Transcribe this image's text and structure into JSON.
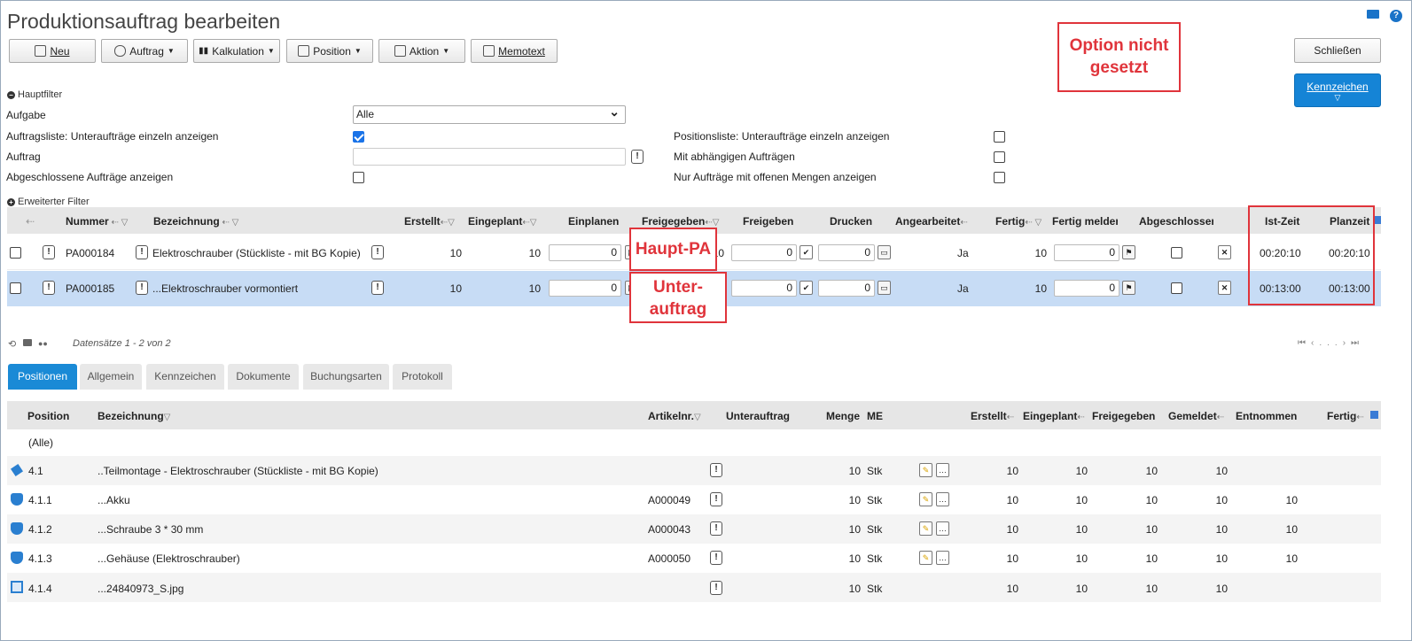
{
  "title": "Produktionsauftrag bearbeiten",
  "toolbar": {
    "neu": "Neu",
    "auftrag": "Auftrag",
    "kalkulation": "Kalkulation",
    "position": "Position",
    "aktion": "Aktion",
    "memotext": "Memotext",
    "schliessen": "Schließen",
    "kennzeichen": "Kennzeichen"
  },
  "annotations": {
    "option_line1": "Option nicht",
    "option_line2": "gesetzt",
    "haupt": "Haupt-PA",
    "unter_line1": "Unter-",
    "unter_line2": "auftrag"
  },
  "filter": {
    "hauptfilter": "Hauptfilter",
    "aufgabe_label": "Aufgabe",
    "aufgabe_value": "Alle",
    "auftragsliste_label": "Auftragsliste: Unteraufträge einzeln anzeigen",
    "auftragsliste_checked": true,
    "positionsliste_label": "Positionsliste: Unteraufträge einzeln anzeigen",
    "auftrag_label": "Auftrag",
    "auftrag_value": "",
    "abhaengig_label": "Mit abhängigen Aufträgen",
    "abgeschlossen_label": "Abgeschlossene Aufträge anzeigen",
    "offene_label": "Nur Aufträge mit offenen Mengen anzeigen",
    "erweitert": "Erweiterter Filter"
  },
  "orders": {
    "headers": {
      "nummer": "Nummer",
      "bezeichnung": "Bezeichnung",
      "erstellt": "Erstellt",
      "eingeplant": "Eingeplant",
      "einplanen": "Einplanen",
      "freigegeben": "Freigegeben",
      "freigeben": "Freigeben",
      "drucken": "Drucken",
      "angearbeitet": "Angearbeitet",
      "fertig": "Fertig",
      "fertig_melden": "Fertig melden",
      "abgeschlossen": "Abgeschlossen",
      "ist_zeit": "Ist-Zeit",
      "planzeit": "Planzeit"
    },
    "rows": [
      {
        "nummer": "PA000184",
        "bezeichnung": "Elektroschrauber (Stückliste - mit BG Kopie)",
        "erstellt": "10",
        "eingeplant": "10",
        "einplanen": "0",
        "freigegeben": "10",
        "freigeben": "0",
        "drucken": "0",
        "angearbeitet": "Ja",
        "fertig": "10",
        "fertig_melden": "0",
        "ist_zeit": "00:20:10",
        "planzeit": "00:20:10"
      },
      {
        "nummer": "PA000185",
        "bezeichnung": "...Elektroschrauber vormontiert",
        "erstellt": "10",
        "eingeplant": "10",
        "einplanen": "0",
        "freigegeben": "10",
        "freigeben": "0",
        "drucken": "0",
        "angearbeitet": "Ja",
        "fertig": "10",
        "fertig_melden": "0",
        "ist_zeit": "00:13:00",
        "planzeit": "00:13:00"
      }
    ],
    "records": "Datensätze 1 - 2 von 2",
    "pager_ellipsis": "..."
  },
  "tabs": [
    "Positionen",
    "Allgemein",
    "Kennzeichen",
    "Dokumente",
    "Buchungsarten",
    "Protokoll"
  ],
  "positions": {
    "headers": {
      "position": "Position",
      "bezeichnung": "Bezeichnung",
      "artikelnr": "Artikelnr.",
      "unterauftrag": "Unterauftrag",
      "menge": "Menge",
      "me": "ME",
      "erstellt": "Erstellt",
      "eingeplant": "Eingeplant",
      "freigegeben": "Freigegeben",
      "gemeldet": "Gemeldet",
      "entnommen": "Entnommen",
      "fertig": "Fertig"
    },
    "all_label": "(Alle)",
    "rows": [
      {
        "pos": "4.1",
        "bez": "..Teilmontage - Elektroschrauber (Stückliste - mit BG Kopie)",
        "art": "",
        "menge": "10",
        "me": "Stk",
        "erstellt": "10",
        "eingeplant": "10",
        "freigegeben": "10",
        "gemeldet": "10",
        "entnommen": "",
        "icon": "assembly-icon",
        "edit": true
      },
      {
        "pos": "4.1.1",
        "bez": "...Akku",
        "art": "A000049",
        "menge": "10",
        "me": "Stk",
        "erstellt": "10",
        "eingeplant": "10",
        "freigegeben": "10",
        "gemeldet": "10",
        "entnommen": "10",
        "icon": "part-icon",
        "edit": true
      },
      {
        "pos": "4.1.2",
        "bez": "...Schraube 3 * 30 mm",
        "art": "A000043",
        "menge": "10",
        "me": "Stk",
        "erstellt": "10",
        "eingeplant": "10",
        "freigegeben": "10",
        "gemeldet": "10",
        "entnommen": "10",
        "icon": "part-icon",
        "edit": true
      },
      {
        "pos": "4.1.3",
        "bez": "...Gehäuse (Elektroschrauber)",
        "art": "A000050",
        "menge": "10",
        "me": "Stk",
        "erstellt": "10",
        "eingeplant": "10",
        "freigegeben": "10",
        "gemeldet": "10",
        "entnommen": "10",
        "icon": "part-icon",
        "edit": true
      },
      {
        "pos": "4.1.4",
        "bez": "...24840973_S.jpg",
        "art": "",
        "menge": "10",
        "me": "Stk",
        "erstellt": "10",
        "eingeplant": "10",
        "freigegeben": "10",
        "gemeldet": "10",
        "entnommen": "",
        "icon": "document-icon",
        "edit": false
      }
    ]
  },
  "colors": {
    "accent": "#1a8ad6",
    "annotation": "#e0343b",
    "selected_row": "#c7dcf5"
  }
}
